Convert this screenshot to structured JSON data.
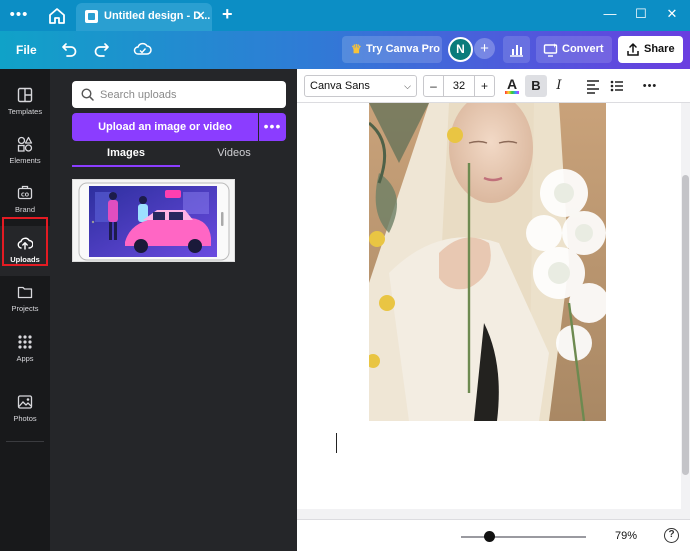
{
  "titlebar": {
    "tab_title": "Untitled design - D...",
    "tab_close": "✕",
    "new_tab": "+",
    "menu_dots": "•••",
    "win_minimize": "—",
    "win_maximize": "☐",
    "win_close": "✕"
  },
  "toolbar": {
    "file_label": "File",
    "try_pro_label": "Try Canva Pro",
    "avatar_initial": "N",
    "add_user": "+",
    "convert_label": "Convert",
    "share_label": "Share"
  },
  "rail": {
    "items": [
      {
        "label": "Templates",
        "icon": "templates-icon"
      },
      {
        "label": "Elements",
        "icon": "elements-icon"
      },
      {
        "label": "Brand",
        "icon": "brand-icon"
      },
      {
        "label": "Uploads",
        "icon": "upload-cloud-icon"
      },
      {
        "label": "Projects",
        "icon": "folder-icon"
      },
      {
        "label": "Apps",
        "icon": "apps-grid-icon"
      },
      {
        "label": "Photos",
        "icon": "photo-icon"
      }
    ],
    "active": "Uploads"
  },
  "panel": {
    "search_placeholder": "Search uploads",
    "upload_label": "Upload an image or video",
    "more_label": "•••",
    "tabs": [
      {
        "label": "Images",
        "active": true
      },
      {
        "label": "Videos",
        "active": false
      }
    ]
  },
  "editor": {
    "font_family": "Canva Sans",
    "font_size": "32",
    "size_minus": "–",
    "size_plus": "+",
    "italic_label": "I",
    "bold_label": "B",
    "text_color_label": "A",
    "more_label": "•••",
    "zoom_label": "79%",
    "zoom_level_percent": 79,
    "help_label": "?"
  },
  "colors": {
    "titlebar": "#0c8ec5",
    "accent": "#8b3dff",
    "rail": "#18191b",
    "panel": "#252629",
    "highlight": "#e31b23"
  }
}
